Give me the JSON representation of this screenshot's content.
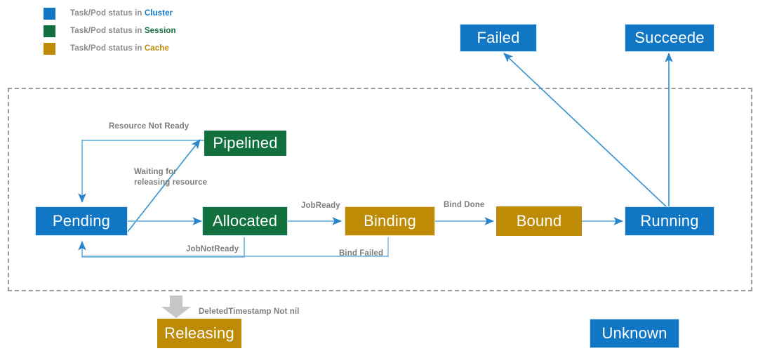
{
  "diagram": {
    "title_present": false,
    "colors": {
      "cluster": "#1177c4",
      "session": "#12703f",
      "cache": "#bd8b06",
      "edge": "#4ca3dd",
      "edge_dark": "#2a86c8",
      "label_text": "#7d7d7d",
      "dashed_border": "#9a9a9a",
      "block_arrow": "#c6c6c6"
    }
  },
  "legend": {
    "items": [
      {
        "swatch": "cluster-swatch",
        "prefix": "Task/Pod status in ",
        "scope": "Cluster",
        "color": "#1177c4"
      },
      {
        "swatch": "session-swatch",
        "prefix": "Task/Pod status in ",
        "scope": "Session",
        "color": "#12703f"
      },
      {
        "swatch": "cache-swatch",
        "prefix": "Task/Pod status in ",
        "scope": "Cache",
        "color": "#bd8b06"
      }
    ]
  },
  "nodes": [
    {
      "id": "failed",
      "label": "Failed",
      "scope": "cluster"
    },
    {
      "id": "succeede",
      "label": "Succeede",
      "scope": "cluster"
    },
    {
      "id": "pipelined",
      "label": "Pipelined",
      "scope": "session"
    },
    {
      "id": "pending",
      "label": "Pending",
      "scope": "cluster"
    },
    {
      "id": "allocated",
      "label": "Allocated",
      "scope": "session"
    },
    {
      "id": "binding",
      "label": "Binding",
      "scope": "cache"
    },
    {
      "id": "bound",
      "label": "Bound",
      "scope": "cache"
    },
    {
      "id": "running",
      "label": "Running",
      "scope": "cluster"
    },
    {
      "id": "releasing",
      "label": "Releasing",
      "scope": "cache"
    },
    {
      "id": "unknown",
      "label": "Unknown",
      "scope": "cluster"
    }
  ],
  "edges": [
    {
      "id": "pipelined-to-pending",
      "from": "pipelined",
      "to": "pending",
      "label": "Resource Not Ready"
    },
    {
      "id": "pending-to-pipelined",
      "from": "pending",
      "to": "pipelined",
      "label": "Waiting for\nreleasing resource",
      "label_line1": "Waiting for",
      "label_line2": "releasing resource"
    },
    {
      "id": "pending-to-allocated",
      "from": "pending",
      "to": "allocated",
      "label": ""
    },
    {
      "id": "allocated-to-binding",
      "from": "allocated",
      "to": "binding",
      "label": "JobReady"
    },
    {
      "id": "binding-to-bound",
      "from": "binding",
      "to": "bound",
      "label": "Bind Done"
    },
    {
      "id": "bound-to-running",
      "from": "bound",
      "to": "running",
      "label": ""
    },
    {
      "id": "allocated-to-pending",
      "from": "allocated",
      "to": "pending",
      "label": "JobNotReady"
    },
    {
      "id": "binding-to-pending",
      "from": "binding",
      "to": "pending",
      "label": "Bind Failed"
    },
    {
      "id": "running-to-failed",
      "from": "running",
      "to": "failed",
      "label": ""
    },
    {
      "id": "running-to-succeede",
      "from": "running",
      "to": "succeede",
      "label": ""
    },
    {
      "id": "cluster-to-releasing",
      "from": "dashed-scope",
      "to": "releasing",
      "label": "DeletedTimestamp Not nil"
    }
  ],
  "labels": {
    "resource_not_ready": "Resource Not Ready",
    "waiting_line1": "Waiting for",
    "waiting_line2": "releasing resource",
    "job_ready": "JobReady",
    "bind_done": "Bind Done",
    "job_not_ready": "JobNotReady",
    "bind_failed": "Bind Failed",
    "deleted_timestamp": "DeletedTimestamp Not nil"
  }
}
